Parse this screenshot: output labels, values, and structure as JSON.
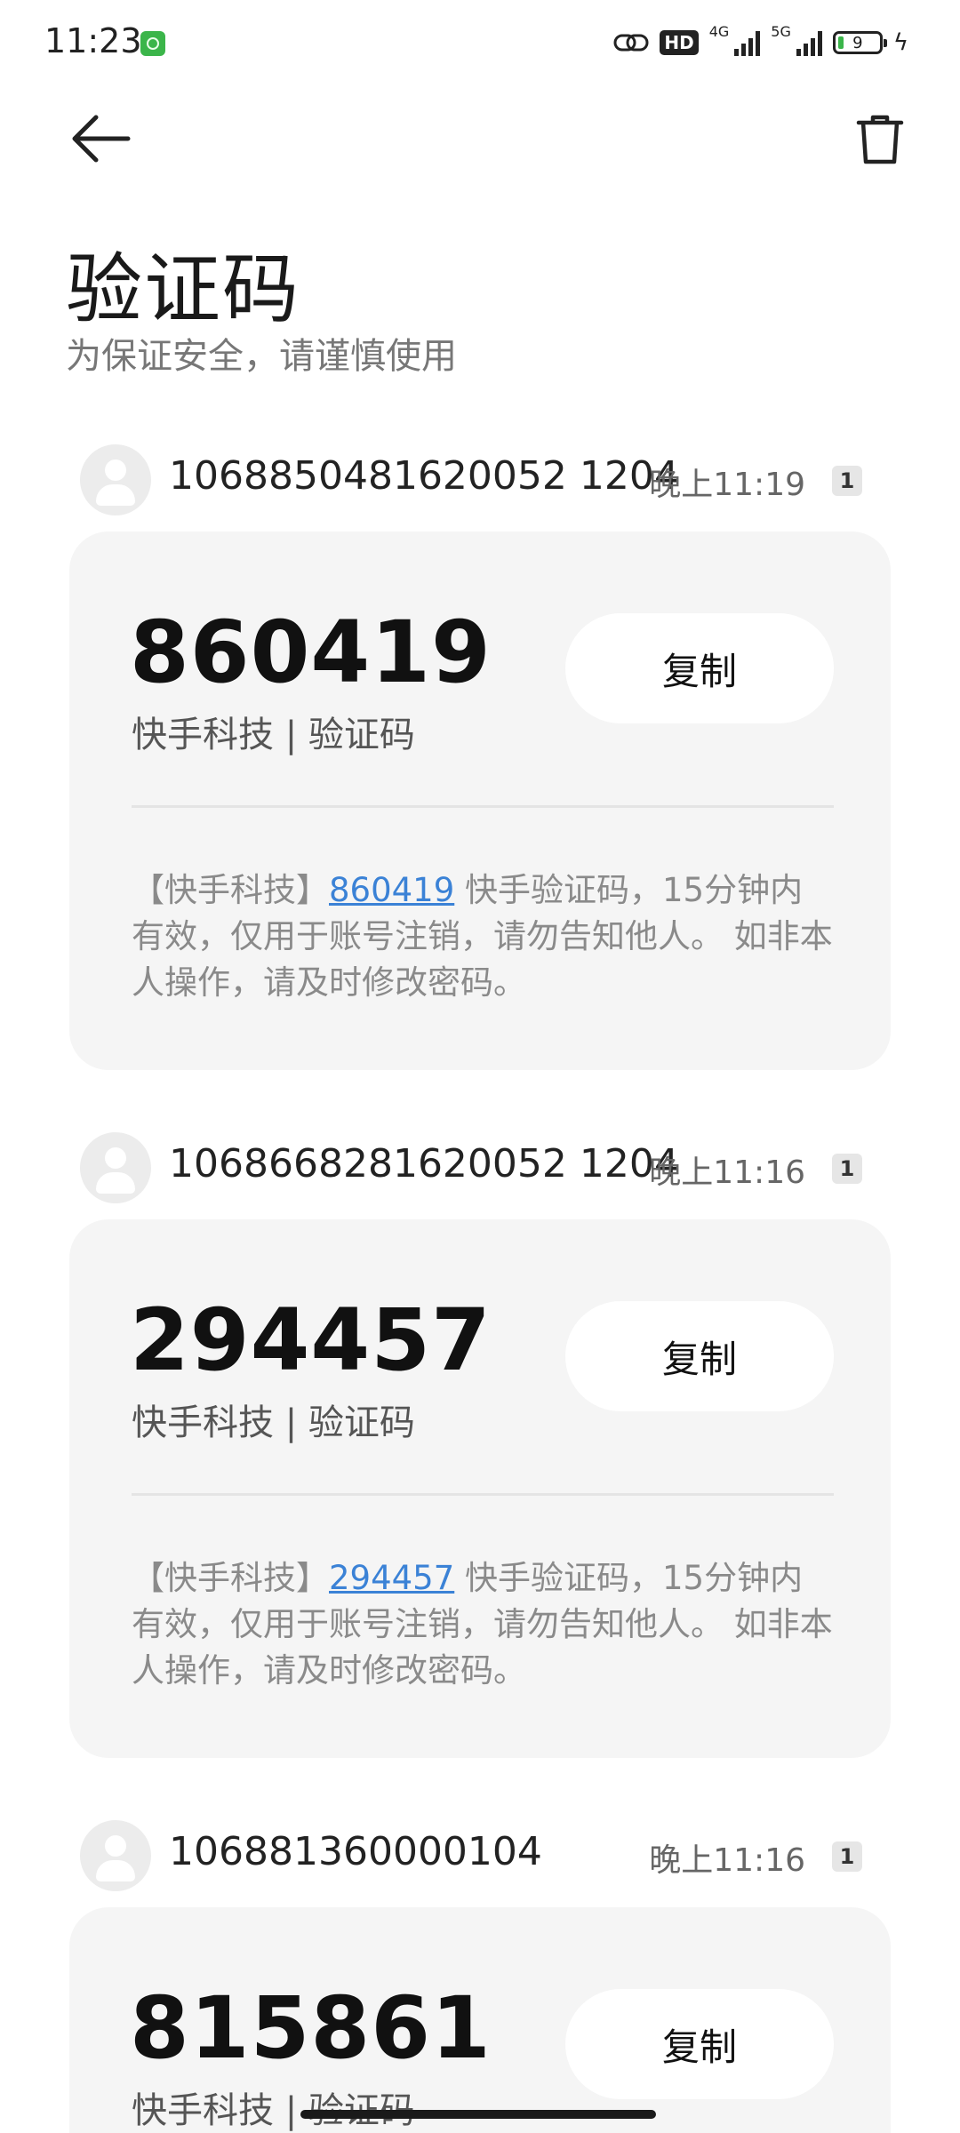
{
  "status_bar": {
    "time": "11:23",
    "hd_label": "HD",
    "net1": "4G",
    "net2": "5G",
    "battery": "9"
  },
  "header": {
    "title": "验证码",
    "subtitle": "为保证安全，请谨慎使用"
  },
  "messages": [
    {
      "sender": "1068850481620052 1204",
      "time": "晚上11:19",
      "sim": "1",
      "code": "860419",
      "label": "快手科技 | 验证码",
      "copy_label": "复制",
      "body_prefix": "【快手科技】",
      "body_code": "860419",
      "body_suffix": " 快手验证码，15分钟内有效，仅用于账号注销，请勿告知他人。 如非本人操作，请及时修改密码。"
    },
    {
      "sender": "1068668281620052 1204",
      "time": "晚上11:16",
      "sim": "1",
      "code": "294457",
      "label": "快手科技 | 验证码",
      "copy_label": "复制",
      "body_prefix": "【快手科技】",
      "body_code": "294457",
      "body_suffix": " 快手验证码，15分钟内有效，仅用于账号注销，请勿告知他人。 如非本人操作，请及时修改密码。"
    },
    {
      "sender": "106881360000104",
      "time": "晚上11:16",
      "sim": "1",
      "code": "815861",
      "label": "快手科技 | 验证码",
      "copy_label": "复制"
    }
  ]
}
